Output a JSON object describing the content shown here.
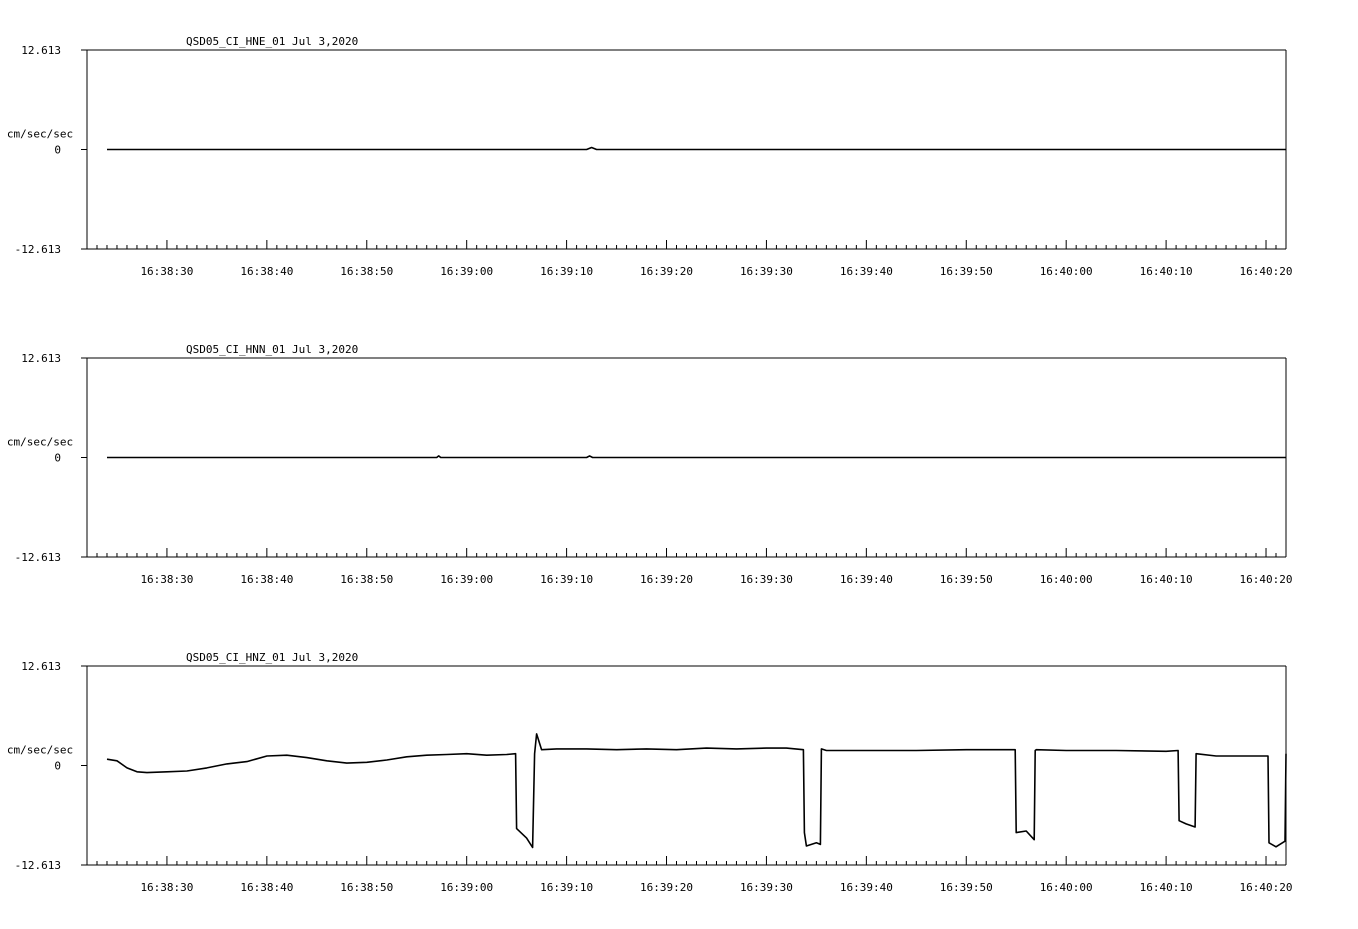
{
  "chart_data": [
    {
      "type": "line",
      "title": "QSD05_CI_HNE_01  Jul 3,2020",
      "ylabel": "cm/sec/sec",
      "ylim": [
        -12.613,
        12.613
      ],
      "yticks": [
        "12.613",
        "0",
        "-12.613"
      ],
      "xlim": [
        "16:38:22",
        "16:40:22"
      ],
      "xticklabels": [
        "16:38:30",
        "16:38:40",
        "16:38:50",
        "16:39:00",
        "16:39:10",
        "16:39:20",
        "16:39:30",
        "16:39:40",
        "16:39:50",
        "16:40:00",
        "16:40:10",
        "16:40:20"
      ],
      "series": [
        {
          "x": [
            "16:38:24",
            "16:39:12",
            "16:39:12.5",
            "16:39:13",
            "16:40:22"
          ],
          "y": [
            0.0,
            0.0,
            0.25,
            0.0,
            0.0
          ]
        }
      ]
    },
    {
      "type": "line",
      "title": "QSD05_CI_HNN_01  Jul 3,2020",
      "ylabel": "cm/sec/sec",
      "ylim": [
        -12.613,
        12.613
      ],
      "yticks": [
        "12.613",
        "0",
        "-12.613"
      ],
      "xlim": [
        "16:38:22",
        "16:40:22"
      ],
      "xticklabels": [
        "16:38:30",
        "16:38:40",
        "16:38:50",
        "16:39:00",
        "16:39:10",
        "16:39:20",
        "16:39:30",
        "16:39:40",
        "16:39:50",
        "16:40:00",
        "16:40:10",
        "16:40:20"
      ],
      "series": [
        {
          "x": [
            "16:38:24",
            "16:38:57",
            "16:38:57.2",
            "16:38:57.4",
            "16:39:12",
            "16:39:12.3",
            "16:39:12.6",
            "16:40:22"
          ],
          "y": [
            0.0,
            0.0,
            0.2,
            0.0,
            0.0,
            0.2,
            0.0,
            0.0
          ]
        }
      ]
    },
    {
      "type": "line",
      "title": "QSD05_CI_HNZ_01  Jul 3,2020",
      "ylabel": "cm/sec/sec",
      "ylim": [
        -12.613,
        12.613
      ],
      "yticks": [
        "12.613",
        "0",
        "-12.613"
      ],
      "xlim": [
        "16:38:22",
        "16:40:22"
      ],
      "xticklabels": [
        "16:38:30",
        "16:38:40",
        "16:38:50",
        "16:39:00",
        "16:39:10",
        "16:39:20",
        "16:39:30",
        "16:39:40",
        "16:39:50",
        "16:40:00",
        "16:40:10",
        "16:40:20"
      ],
      "series": [
        {
          "x": [
            "16:38:24",
            "16:38:25",
            "16:38:26",
            "16:38:27",
            "16:38:28",
            "16:38:30",
            "16:38:32",
            "16:38:34",
            "16:38:36",
            "16:38:38",
            "16:38:40",
            "16:38:42",
            "16:38:44",
            "16:38:46",
            "16:38:48",
            "16:38:50",
            "16:38:52",
            "16:38:54",
            "16:38:56",
            "16:38:58",
            "16:39:00",
            "16:39:02",
            "16:39:04",
            "16:39:04.9",
            "16:39:05",
            "16:39:06",
            "16:39:06.6",
            "16:39:06.8",
            "16:39:07",
            "16:39:07.5",
            "16:39:09",
            "16:39:12",
            "16:39:15",
            "16:39:18",
            "16:39:21",
            "16:39:24",
            "16:39:27",
            "16:39:30",
            "16:39:32",
            "16:39:33.7",
            "16:39:33.8",
            "16:39:34",
            "16:39:35",
            "16:39:35.4",
            "16:39:35.5",
            "16:39:36",
            "16:39:40",
            "16:39:45",
            "16:39:50",
            "16:39:54.9",
            "16:39:55",
            "16:39:56",
            "16:39:56.8",
            "16:39:56.9",
            "16:39:57",
            "16:40:00",
            "16:40:05",
            "16:40:10",
            "16:40:11.2",
            "16:40:11.3",
            "16:40:12",
            "16:40:12.9",
            "16:40:13",
            "16:40:15",
            "16:40:18",
            "16:40:20.2",
            "16:40:20.3",
            "16:40:21",
            "16:40:21.9",
            "16:40:22"
          ],
          "y": [
            0.8,
            0.6,
            -0.3,
            -0.8,
            -0.9,
            -0.8,
            -0.7,
            -0.3,
            0.2,
            0.5,
            1.2,
            1.3,
            1.0,
            0.6,
            0.3,
            0.4,
            0.7,
            1.1,
            1.3,
            1.4,
            1.5,
            1.3,
            1.4,
            1.5,
            -8.0,
            -9.2,
            -10.4,
            1.5,
            4.0,
            2.0,
            2.1,
            2.1,
            2.0,
            2.1,
            2.0,
            2.2,
            2.1,
            2.2,
            2.2,
            2.0,
            -8.5,
            -10.2,
            -9.8,
            -10.0,
            2.1,
            1.9,
            1.9,
            1.9,
            2.0,
            2.0,
            -8.5,
            -8.3,
            -9.4,
            1.9,
            2.0,
            1.9,
            1.9,
            1.8,
            1.9,
            -7.0,
            -7.4,
            -7.8,
            1.5,
            1.2,
            1.2,
            1.2,
            -9.8,
            -10.3,
            -9.6,
            1.5
          ]
        }
      ]
    }
  ]
}
